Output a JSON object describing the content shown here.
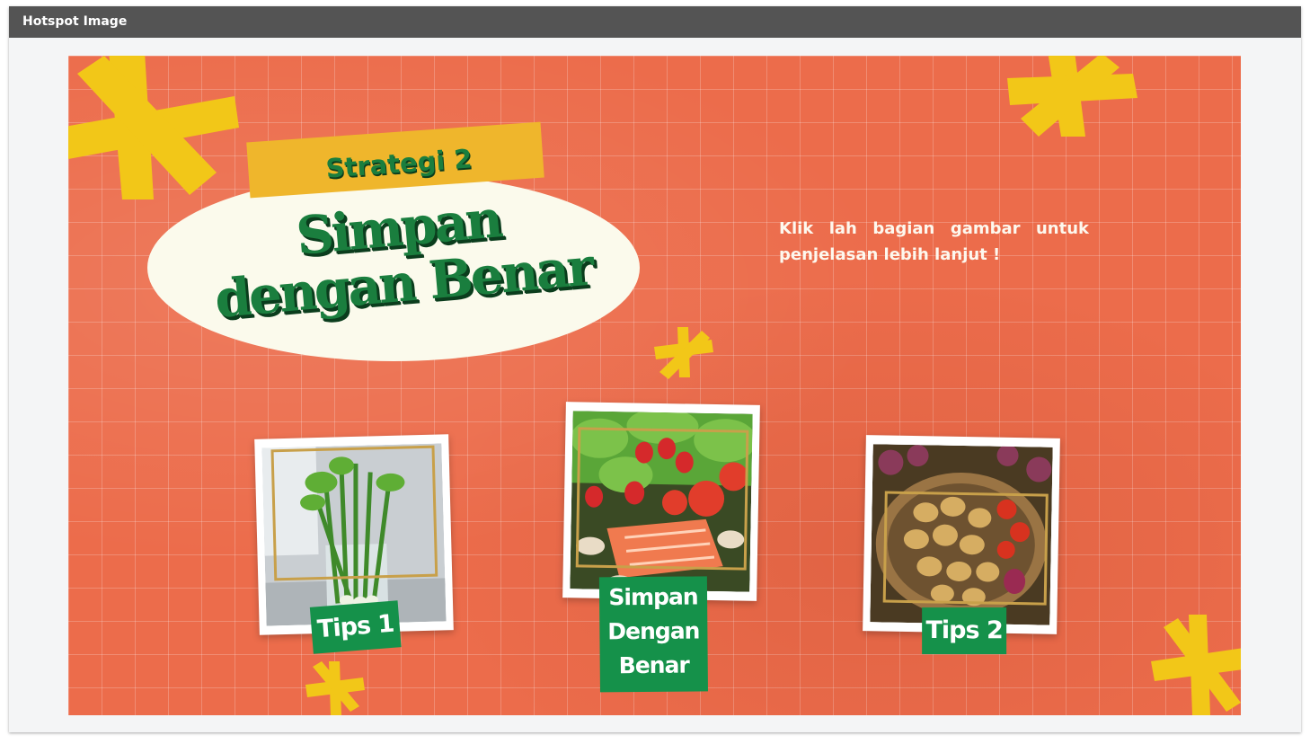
{
  "window": {
    "title": "Hotspot Image"
  },
  "slide": {
    "strategy_tag": "Strategi 2",
    "headline_line1": "Simpan",
    "headline_line2": "dengan Benar",
    "instruction": "Klik lah bagian gambar untuk penjelasan lebih lanjut !"
  },
  "hotspots": [
    {
      "id": "tips1",
      "label": "Tips 1",
      "image": "celery-and-leeks-in-glass"
    },
    {
      "id": "simpan",
      "label_lines": [
        "Simpan",
        "Dengan",
        "Benar"
      ],
      "image": "salad-strawberries-tomatoes-salmon"
    },
    {
      "id": "tips2",
      "label": "Tips 2",
      "image": "basket-of-potatoes-onions-tomatoes"
    }
  ],
  "colors": {
    "background": "#ec6c4b",
    "accent_yellow": "#efb62c",
    "headline_green": "#1a7e3e",
    "label_green": "#15914a",
    "oval": "#fbfaec",
    "titlebar": "#545454"
  },
  "icons": [
    "asterisk-doodle-icon"
  ]
}
